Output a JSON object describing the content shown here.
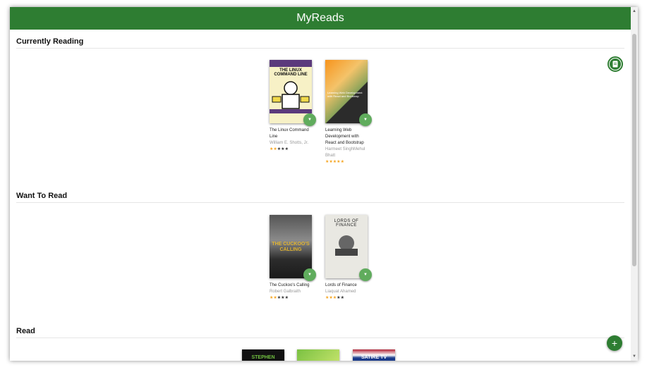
{
  "app": {
    "title": "MyReads"
  },
  "shelves": [
    {
      "title": "Currently Reading"
    },
    {
      "title": "Want To Read"
    },
    {
      "title": "Read"
    }
  ],
  "books": {
    "linux": {
      "title": "The Linux Command Line",
      "authors": "William E. Shotts, Jr.",
      "cover_text": "THE LINUX COMMAND LINE",
      "rating": 2
    },
    "webdev": {
      "title": "Learning Web Development with React and Bootstrap",
      "authors": "Harmeet SinghMehul Bhatt",
      "cover_text": "Learning Web Development with React and Bootstrap",
      "rating": 5
    },
    "cuckoo": {
      "title": "The Cuckoo's Calling",
      "authors": "Robert Galbraith",
      "cover_text": "THE CUCKOO'S CALLING",
      "rating": 2
    },
    "finance": {
      "title": "Lords of Finance",
      "authors": "Liaquat Ahamed",
      "cover_text": "LORDS OF FINANCE",
      "rating": 3
    }
  },
  "read_covers": [
    {
      "cover_text": "STEPHEN"
    },
    {
      "cover_text": ""
    },
    {
      "cover_text": "SATIRE TV"
    }
  ],
  "icons": {
    "shelf_changer": "chevron-down-icon",
    "search": "book-icon",
    "add": "plus-icon"
  },
  "colors": {
    "header": "#2e7d32",
    "changer": "#60ac5d",
    "star": "#f5a623"
  }
}
